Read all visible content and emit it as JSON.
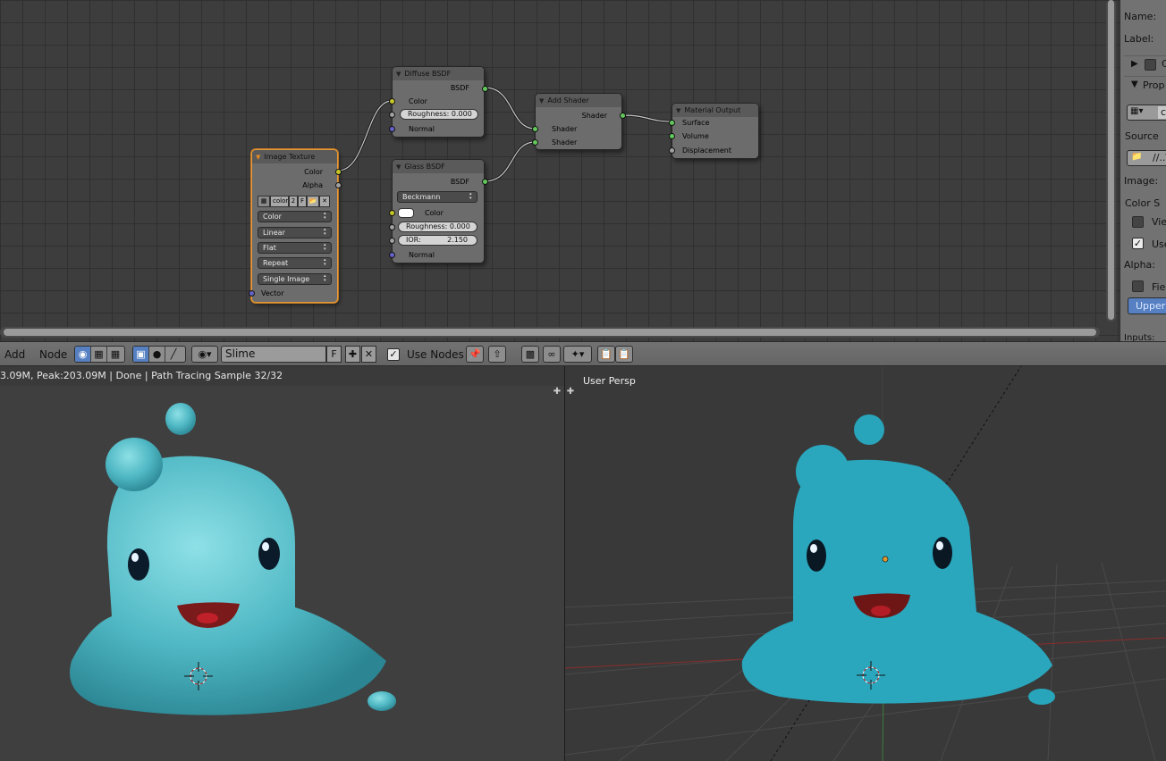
{
  "node_editor": {
    "nodes": {
      "image_texture": {
        "title": "Image Texture",
        "out_color": "Color",
        "out_alpha": "Alpha",
        "image_name": "color",
        "image_users": "2",
        "fake_user": "F",
        "color_space": "Color",
        "interpolation": "Linear",
        "projection": "Flat",
        "extension": "Repeat",
        "source": "Single Image",
        "in_vector": "Vector"
      },
      "diffuse_bsdf": {
        "title": "Diffuse BSDF",
        "out_bsdf": "BSDF",
        "in_color": "Color",
        "roughness": "Roughness: 0.000",
        "in_normal": "Normal"
      },
      "glass_bsdf": {
        "title": "Glass BSDF",
        "out_bsdf": "BSDF",
        "distribution": "Beckmann",
        "in_color": "Color",
        "roughness": "Roughness: 0.000",
        "ior_label": "IOR:",
        "ior_value": "2.150",
        "in_normal": "Normal"
      },
      "add_shader": {
        "title": "Add Shader",
        "out_shader": "Shader",
        "in_shader_1": "Shader",
        "in_shader_2": "Shader"
      },
      "material_output": {
        "title": "Material Output",
        "in_surface": "Surface",
        "in_volume": "Volume",
        "in_displacement": "Displacement"
      }
    }
  },
  "properties": {
    "name_label": "Name:",
    "label_label": "Label:",
    "color_panel_label": "C",
    "props_panel_label": "Prop",
    "image_btn_text": "c",
    "source_label": "Source",
    "path_text": "//..\\",
    "image_label": "Image:",
    "color_space_label": "Color S",
    "view_label": "View",
    "use_label": "Use",
    "alpha_label": "Alpha:",
    "fields_label": "Fiel",
    "upper_label": "Upper",
    "inputs_label": "Inputs:"
  },
  "header": {
    "menu_add": "Add",
    "menu_node": "Node",
    "material_name": "Slime",
    "fake_user": "F",
    "use_nodes_label": "Use Nodes"
  },
  "render_view": {
    "status": "3.09M, Peak:203.09M | Done | Path Tracing Sample 32/32"
  },
  "viewport_3d": {
    "label": "User Persp"
  },
  "colors": {
    "slime_render": "#4fb8c4",
    "slime_solid": "#2aa7bd",
    "active_node_border": "#e59a3a",
    "socket_green": "#62c85b",
    "socket_yellow": "#c7c729",
    "socket_blue": "#6363c7",
    "selected_tab": "#5680c2"
  }
}
